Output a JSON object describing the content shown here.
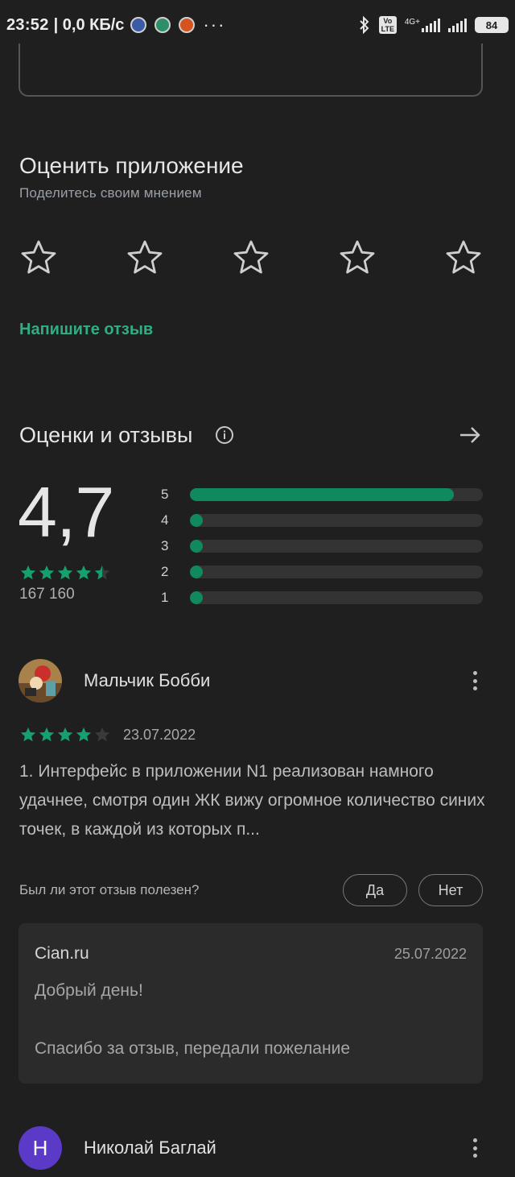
{
  "status_bar": {
    "time": "23:52",
    "speed": "| 0,0 КБ/с",
    "network_label": "4G+",
    "volte_label": "Vo LTE",
    "battery": "84"
  },
  "rate_section": {
    "title": "Оценить приложение",
    "subtitle": "Поделитесь своим мнением",
    "star_count": 5,
    "write_review": "Напишите отзыв",
    "accent_color": "#2fae83"
  },
  "ratings": {
    "title": "Оценки и отзывы",
    "average": "4,7",
    "average_stars": 4.5,
    "total_count": "167 160",
    "distribution": [
      {
        "label": "5",
        "fraction": 0.9
      },
      {
        "label": "4",
        "fraction": 0.04
      },
      {
        "label": "3",
        "fraction": 0.04
      },
      {
        "label": "2",
        "fraction": 0.04
      },
      {
        "label": "1",
        "fraction": 0.04
      }
    ],
    "bar_color": "#0f8a5f"
  },
  "reviews": [
    {
      "author": "Мальчик Бобби",
      "stars": 4,
      "date": "23.07.2022",
      "text": "1. Интерфейс в приложении N1 реализован намного удачнее, смотря один ЖК вижу огромное количество синих точек, в каждой из которых п...",
      "helpful_question": "Был ли этот отзыв полезен?",
      "yes": "Да",
      "no": "Нет",
      "reply": {
        "developer": "Cian.ru",
        "date": "25.07.2022",
        "line1": "Добрый день!",
        "line2": "Спасибо за отзыв, передали пожелание"
      }
    },
    {
      "author": "Николай Баглай",
      "avatar_letter": "Н"
    }
  ]
}
